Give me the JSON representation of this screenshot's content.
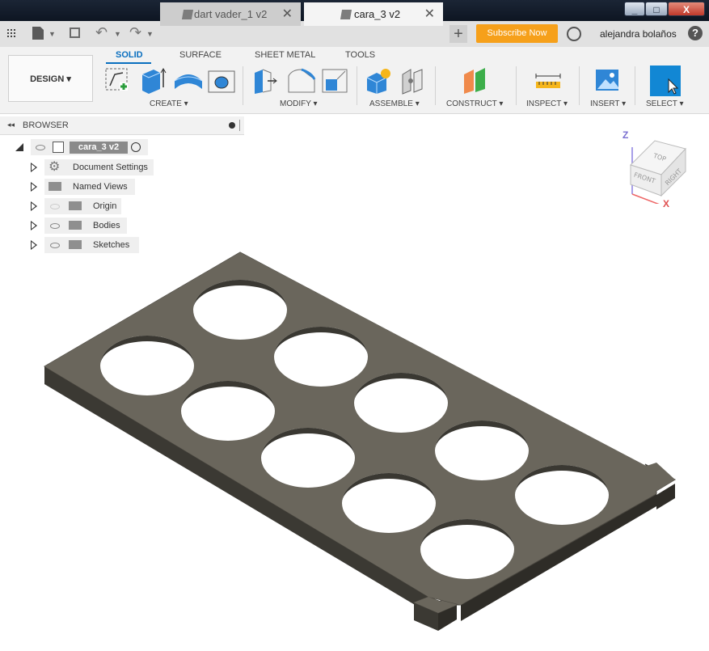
{
  "window": {
    "min": "_",
    "max": "□",
    "close": "X"
  },
  "tabs": [
    {
      "label": "dart vader_1 v2"
    },
    {
      "label": "cara_3 v2"
    }
  ],
  "tab_close": "✕",
  "subscribe_label": "Subscribe Now",
  "user_name": "alejandra bolaños",
  "help_label": "?",
  "design_label": "DESIGN ▾",
  "toolbar_tabs": [
    "SOLID",
    "SURFACE",
    "SHEET METAL",
    "TOOLS"
  ],
  "groups": [
    "CREATE ▾",
    "MODIFY ▾",
    "ASSEMBLE ▾",
    "CONSTRUCT ▾",
    "INSPECT ▾",
    "INSERT ▾",
    "SELECT ▾"
  ],
  "browser": {
    "title": "BROWSER",
    "root": "cara_3 v2",
    "items": [
      "Document Settings",
      "Named Views",
      "Origin",
      "Bodies",
      "Sketches"
    ]
  },
  "viewcube": {
    "top": "TOP",
    "front": "FRONT",
    "right": "RIGHT",
    "z": "Z",
    "x": "X"
  },
  "colors": {
    "accent": "#0a6fbf",
    "subscribe": "#f6a01a",
    "body": "#6a665c"
  }
}
